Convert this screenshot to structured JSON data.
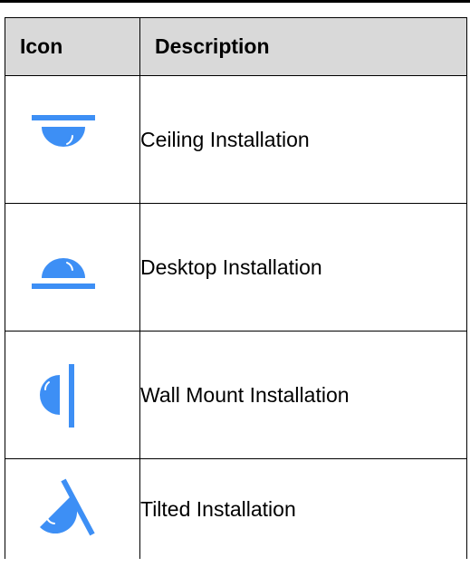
{
  "table": {
    "header": {
      "icon": "Icon",
      "description": "Description"
    },
    "rows": [
      {
        "icon": "ceiling-installation-icon",
        "description": "Ceiling Installation"
      },
      {
        "icon": "desktop-installation-icon",
        "description": "Desktop Installation"
      },
      {
        "icon": "wall-mount-installation-icon",
        "description": "Wall Mount Installation"
      },
      {
        "icon": "tilted-installation-icon",
        "description": "Tilted Installation"
      }
    ]
  },
  "colors": {
    "icon_blue": "#3d8ff5",
    "header_background": "#d9d9d9",
    "border": "#000000"
  }
}
